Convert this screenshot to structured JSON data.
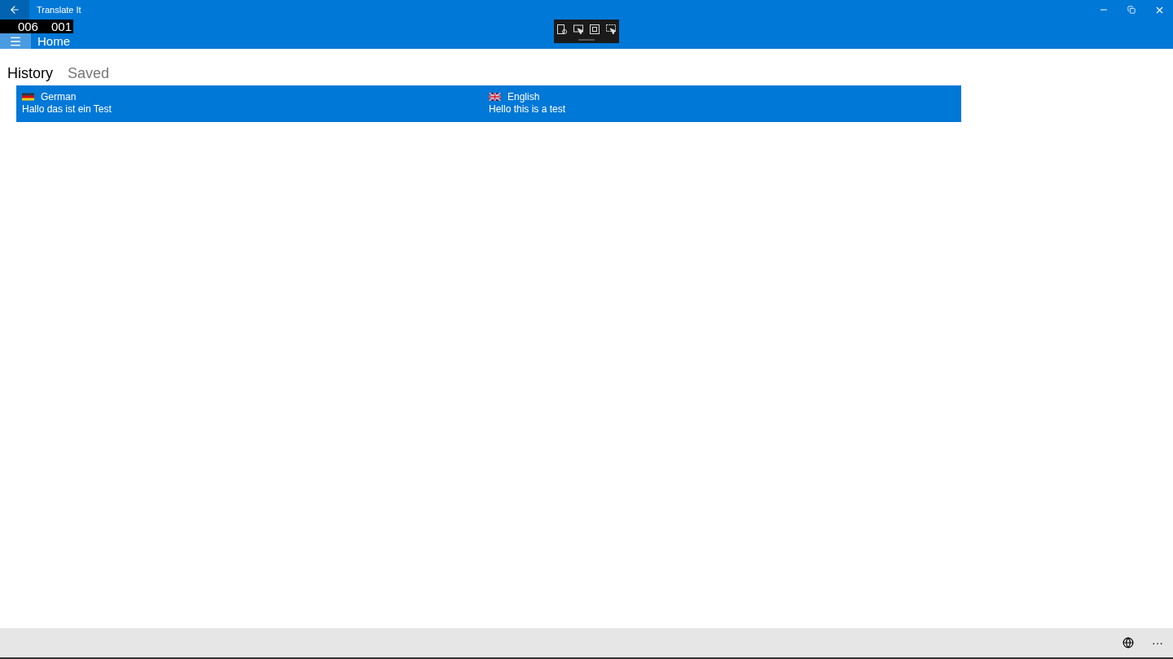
{
  "window": {
    "title": "Translate It"
  },
  "header": {
    "title": "Home"
  },
  "frame_counter": [
    "006",
    "001"
  ],
  "tabs": [
    {
      "label": "History",
      "selected": true
    },
    {
      "label": "Saved",
      "selected": false
    }
  ],
  "history": [
    {
      "source": {
        "language": "German",
        "text": "Hallo das ist ein Test",
        "kind": "de"
      },
      "target": {
        "language": "English",
        "text": "Hello this is a test",
        "kind": "gb"
      },
      "selected": true
    }
  ],
  "command_bar": {
    "more": "···"
  }
}
